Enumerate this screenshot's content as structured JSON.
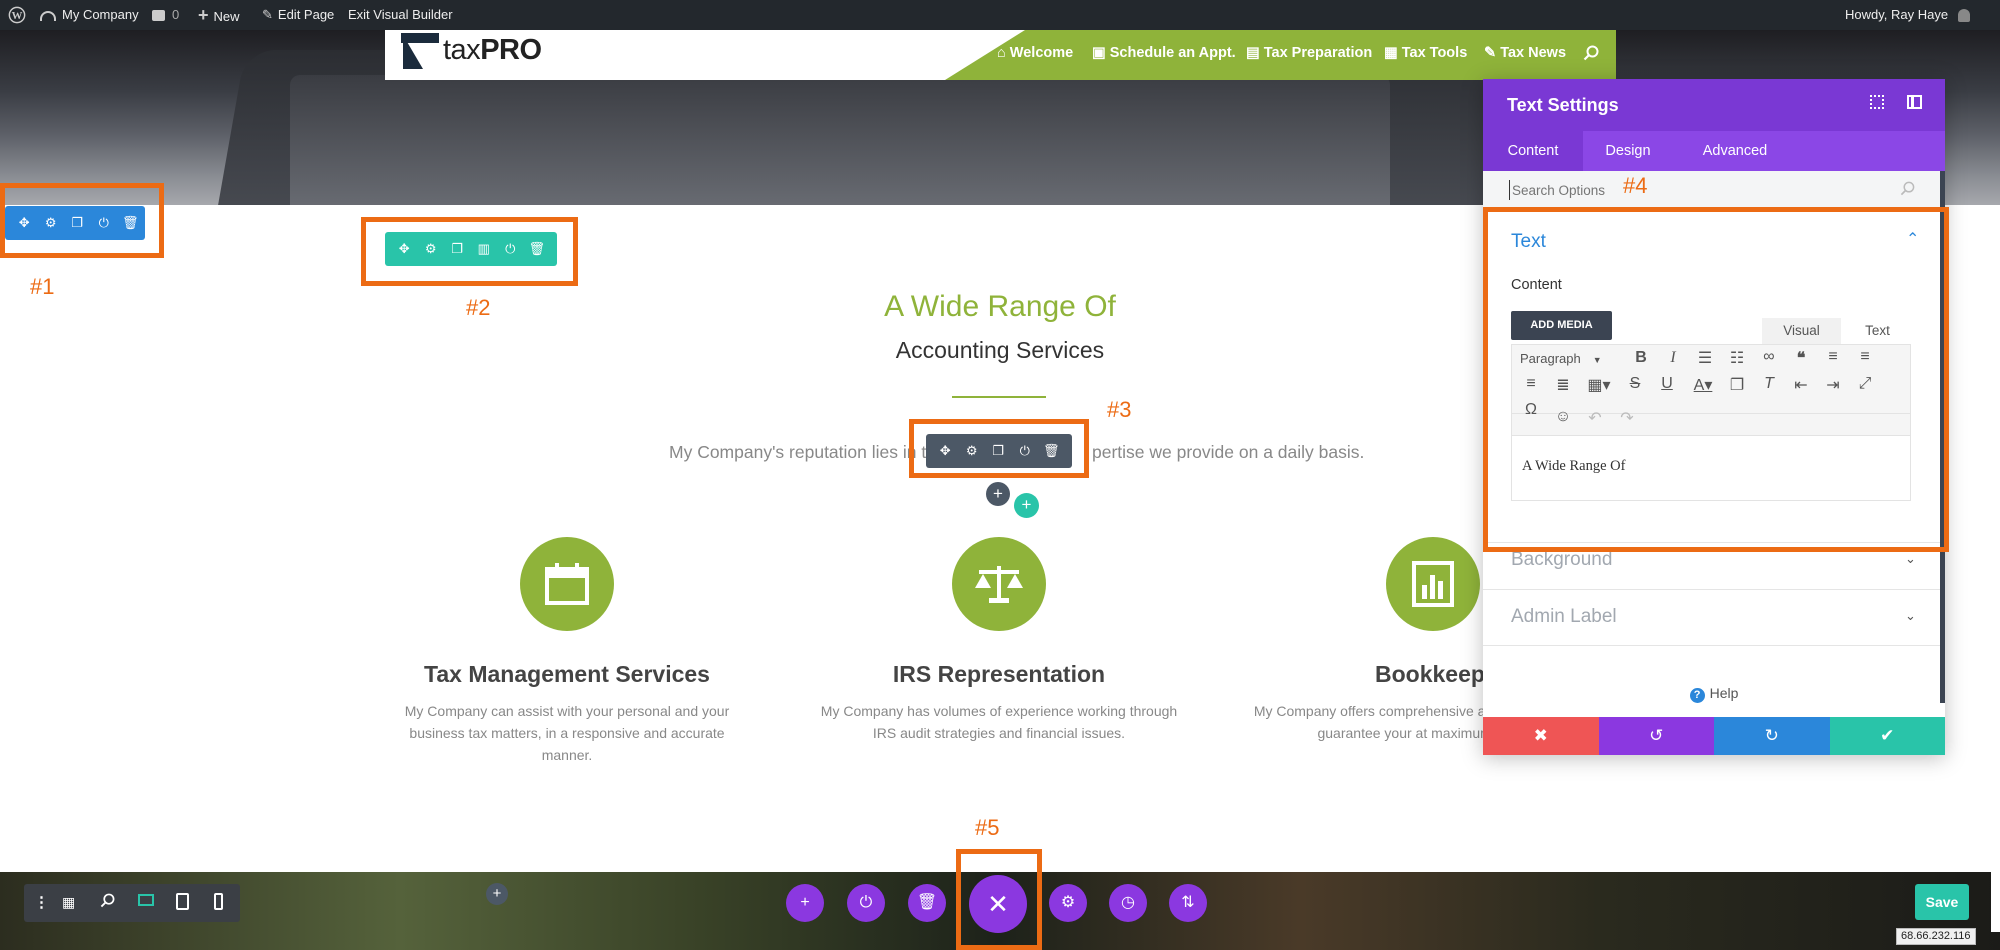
{
  "admin_bar": {
    "site_name": "My Company",
    "comments_count": "0",
    "new_label": "New",
    "edit_page_label": "Edit Page",
    "exit_vb_label": "Exit Visual Builder",
    "greeting": "Howdy, Ray Haye"
  },
  "header": {
    "logo_tax": "tax",
    "logo_pro": "PRO",
    "nav": [
      {
        "icon": "home-icon",
        "label": "Welcome"
      },
      {
        "icon": "calendar-icon",
        "label": "Schedule an Appt."
      },
      {
        "icon": "file-icon",
        "label": "Tax Preparation"
      },
      {
        "icon": "calculator-icon",
        "label": "Tax Tools"
      },
      {
        "icon": "edit-icon",
        "label": "Tax News"
      }
    ]
  },
  "callouts": [
    "#1",
    "#2",
    "#3",
    "#4",
    "#5"
  ],
  "main": {
    "heading_line1": "A Wide Range Of",
    "heading_line2": "Accounting Services",
    "tagline_left": "My Company's reputation lies in th",
    "tagline_right": "pertise we provide on a daily basis.",
    "services": [
      {
        "icon": "calendar-icon",
        "title": "Tax Management Services",
        "desc": "My Company can assist with your personal and your business tax matters, in a responsive and accurate manner."
      },
      {
        "icon": "scale-icon",
        "title": "IRS Representation",
        "desc": "My Company has volumes of experience working through IRS audit strategies and financial issues."
      },
      {
        "icon": "chart-icon",
        "title": "Bookkeeping",
        "desc": "My Company offers comprehensive accounting services to guarantee your at maximum potential."
      }
    ]
  },
  "panel": {
    "title": "Text Settings",
    "tabs": [
      "Content",
      "Design",
      "Advanced"
    ],
    "active_tab": "Content",
    "search_placeholder": "Search Options",
    "text_section": "Text",
    "content_label": "Content",
    "add_media": "ADD MEDIA",
    "editor_tabs": [
      "Visual",
      "Text"
    ],
    "format_select": "Paragraph",
    "editor_content": "A Wide Range Of",
    "background_section": "Background",
    "admin_label_section": "Admin Label",
    "help_label": "Help"
  },
  "bottom": {
    "save_label": "Save",
    "ip_address": "68.66.232.116"
  },
  "colors": {
    "admin_bar": "#23282d",
    "brand_green": "#8fb33a",
    "teal": "#29c4a9",
    "purple": "#8b47e6",
    "orange_callout": "#ec6b14",
    "blue_toolbar": "#2b87da",
    "dark_toolbar": "#4c5866"
  }
}
